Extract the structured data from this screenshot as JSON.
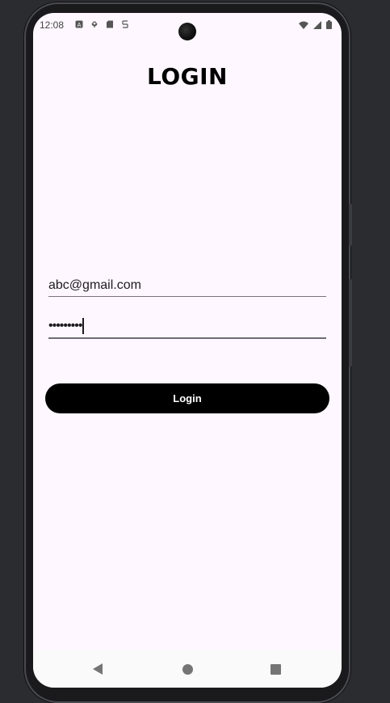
{
  "status_bar": {
    "time": "12:08",
    "left_icons": [
      "a-notification-icon",
      "podcast-icon",
      "sd-card-icon",
      "sim-icon"
    ],
    "right_icons": [
      "wifi-icon",
      "signal-icon",
      "battery-icon"
    ]
  },
  "screen": {
    "title": "LOGIN",
    "email_field": {
      "value": "abc@gmail.com"
    },
    "password_field": {
      "masked_value": "•••••••••"
    },
    "login_button": {
      "label": "Login"
    }
  },
  "nav_bar": {
    "buttons": [
      "back",
      "home",
      "recents"
    ]
  },
  "colors": {
    "background": "#fef7ff",
    "button": "#000000",
    "button_text": "#ffffff",
    "underline": "#79747e"
  }
}
